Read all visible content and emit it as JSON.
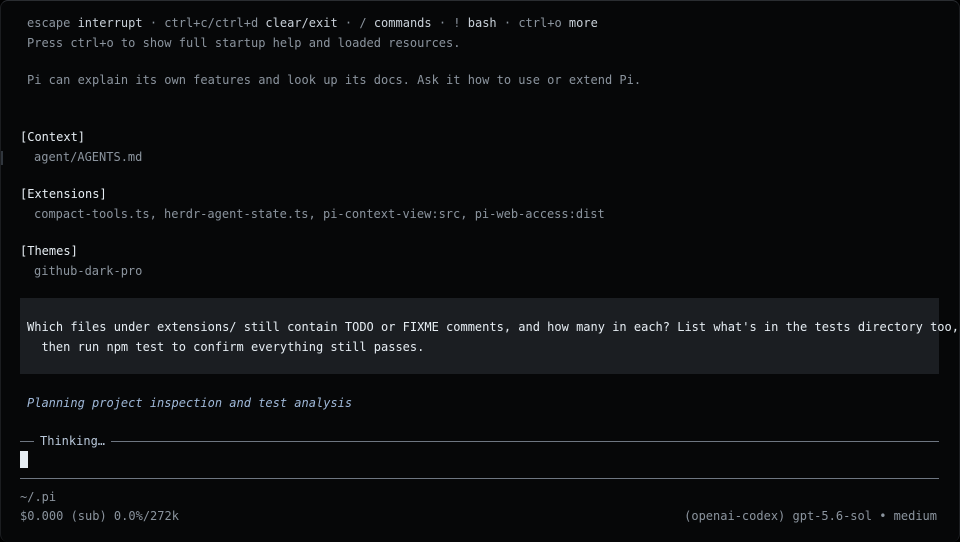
{
  "hints": {
    "line1": [
      {
        "text": "escape",
        "style": "dim"
      },
      {
        "text": " interrupt",
        "style": "key"
      },
      {
        "text": " · ctrl+c/ctrl+d",
        "style": "dim"
      },
      {
        "text": " clear/exit",
        "style": "key"
      },
      {
        "text": " · /",
        "style": "dim"
      },
      {
        "text": " commands",
        "style": "key"
      },
      {
        "text": " · !",
        "style": "dim"
      },
      {
        "text": " bash",
        "style": "key"
      },
      {
        "text": " · ctrl+o",
        "style": "dim"
      },
      {
        "text": " more",
        "style": "key"
      }
    ],
    "line2": "Press ctrl+o to show full startup help and loaded resources.",
    "line3": "Pi can explain its own features and look up its docs. Ask it how to use or extend Pi."
  },
  "sections": {
    "context": {
      "title": "[Context]",
      "body": "agent/AGENTS.md"
    },
    "extensions": {
      "title": "[Extensions]",
      "body": "compact-tools.ts, herdr-agent-state.ts, pi-context-view:src, pi-web-access:dist"
    },
    "themes": {
      "title": "[Themes]",
      "body": "github-dark-pro"
    }
  },
  "prompt": {
    "line1": "Which files under extensions/ still contain TODO or FIXME comments, and how many in each? List what's in the tests directory too,",
    "line2": "  then run npm test to confirm everything still passes."
  },
  "status": {
    "plan": "Planning project inspection and test analysis",
    "thinking": "Thinking…"
  },
  "footer": {
    "cwd": "~/.pi",
    "cost": "$0.000 (sub) 0.0%/272k",
    "model": "(openai-codex) gpt-5.6-sol • medium"
  },
  "colors": {
    "background": "#060708",
    "prompt_bg": "#1b1e22",
    "dim_text": "#8b949e",
    "bright_text": "#e6edf3",
    "plan_text": "#9fb8d8"
  }
}
